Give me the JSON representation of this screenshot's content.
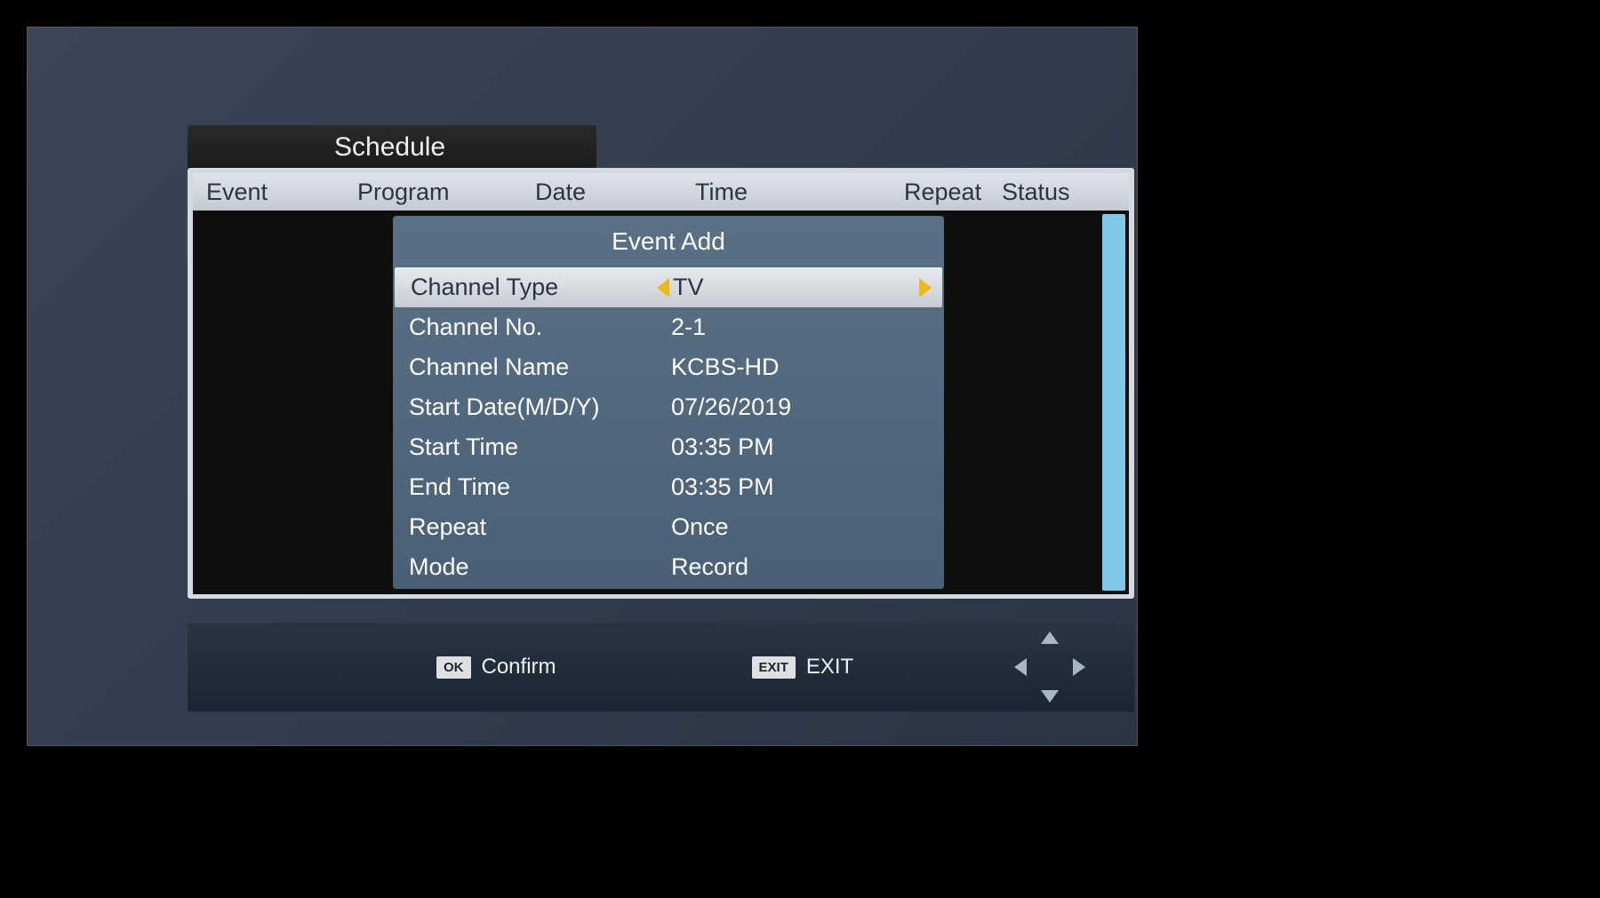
{
  "page_title": "Schedule",
  "columns": {
    "event": "Event",
    "program": "Program",
    "date": "Date",
    "time": "Time",
    "repeat": "Repeat",
    "status": "Status"
  },
  "dialog": {
    "title": "Event Add",
    "rows": [
      {
        "label": "Channel Type",
        "value": "TV",
        "selected": true
      },
      {
        "label": "Channel No.",
        "value": "2-1",
        "selected": false
      },
      {
        "label": "Channel Name",
        "value": "KCBS-HD",
        "selected": false
      },
      {
        "label": "Start Date(M/D/Y)",
        "value": "07/26/2019",
        "selected": false
      },
      {
        "label": "Start Time",
        "value": "03:35 PM",
        "selected": false
      },
      {
        "label": "End Time",
        "value": "03:35 PM",
        "selected": false
      },
      {
        "label": "Repeat",
        "value": "Once",
        "selected": false
      },
      {
        "label": "Mode",
        "value": "Record",
        "selected": false
      }
    ]
  },
  "footer": {
    "ok_badge": "OK",
    "ok_label": "Confirm",
    "exit_badge": "EXIT",
    "exit_label": "EXIT"
  }
}
